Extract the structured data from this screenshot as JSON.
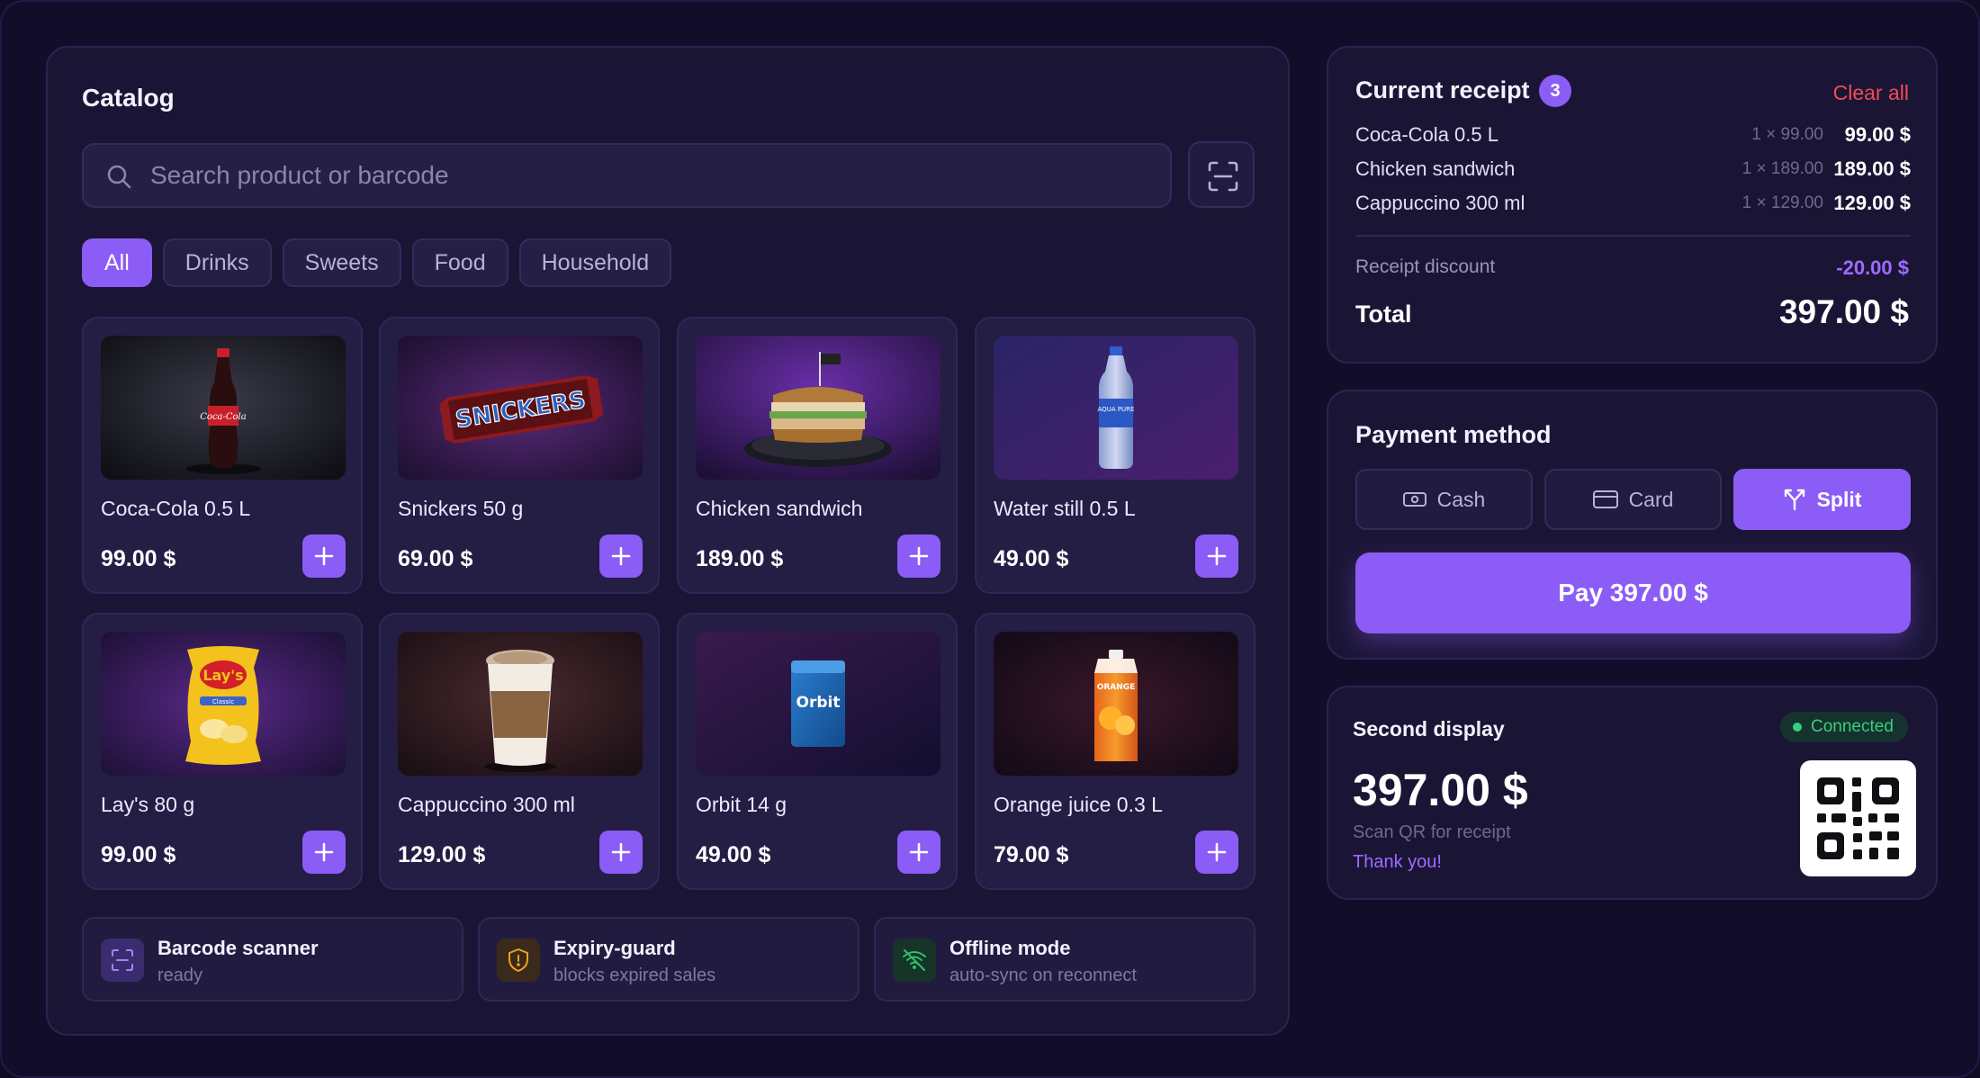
{
  "catalog": {
    "title": "Catalog",
    "search_placeholder": "Search product or barcode",
    "categories": [
      "All",
      "Drinks",
      "Sweets",
      "Food",
      "Household"
    ],
    "active_category": "All",
    "products": [
      {
        "name": "Coca-Cola 0.5 L",
        "price": "99.00 $",
        "image": "cola-bottle"
      },
      {
        "name": "Snickers 50 g",
        "price": "69.00 $",
        "image": "snickers-bar"
      },
      {
        "name": "Chicken sandwich",
        "price": "189.00 $",
        "image": "chicken-sandwich"
      },
      {
        "name": "Water still 0.5 L",
        "price": "49.00 $",
        "image": "water-bottle"
      },
      {
        "name": "Lay's 80 g",
        "price": "99.00 $",
        "image": "chips-bag"
      },
      {
        "name": "Cappuccino 300 ml",
        "price": "129.00 $",
        "image": "coffee-cup"
      },
      {
        "name": "Orbit 14 g",
        "price": "49.00 $",
        "image": "gum-pack"
      },
      {
        "name": "Orange juice 0.3 L",
        "price": "79.00 $",
        "image": "juice-carton"
      }
    ],
    "image_labels": {
      "cola": "Coca-Cola",
      "snickers": "SNICKERS",
      "water": "AQUA PURE",
      "chips": "Lay's",
      "chips_sub": "Classic",
      "gum": "Orbit",
      "juice": "ORANGE"
    },
    "features": [
      {
        "title": "Barcode scanner",
        "subtitle": "ready",
        "icon": "barcode-scan-icon"
      },
      {
        "title": "Expiry-guard",
        "subtitle": "blocks expired sales",
        "icon": "shield-alert-icon"
      },
      {
        "title": "Offline mode",
        "subtitle": "auto-sync on reconnect",
        "icon": "wifi-off-icon"
      }
    ]
  },
  "receipt": {
    "title": "Current receipt",
    "count": "3",
    "clear_label": "Clear all",
    "lines": [
      {
        "name": "Coca-Cola 0.5 L",
        "qty": "1 × 99.00",
        "amount": "99.00 $"
      },
      {
        "name": "Chicken sandwich",
        "qty": "1 × 189.00",
        "amount": "189.00 $"
      },
      {
        "name": "Cappuccino 300 ml",
        "qty": "1 × 129.00",
        "amount": "129.00 $"
      }
    ],
    "discount_label": "Receipt discount",
    "discount_value": "-20.00 $",
    "total_label": "Total",
    "total_value": "397.00 $"
  },
  "payment": {
    "title": "Payment method",
    "methods": [
      {
        "label": "Cash",
        "icon": "cash-icon"
      },
      {
        "label": "Card",
        "icon": "card-icon"
      },
      {
        "label": "Split",
        "icon": "split-icon"
      }
    ],
    "active_method": "Split",
    "pay_label": "Pay 397.00 $"
  },
  "second_display": {
    "title": "Second display",
    "status": "Connected",
    "total": "397.00 $",
    "scan_text": "Scan QR for receipt",
    "thanks_text": "Thank you!"
  },
  "colors": {
    "accent": "#8b5cf6",
    "background": "#120d29",
    "panel": "#1b1535",
    "danger": "#ef4b57",
    "success": "#35d07f"
  }
}
